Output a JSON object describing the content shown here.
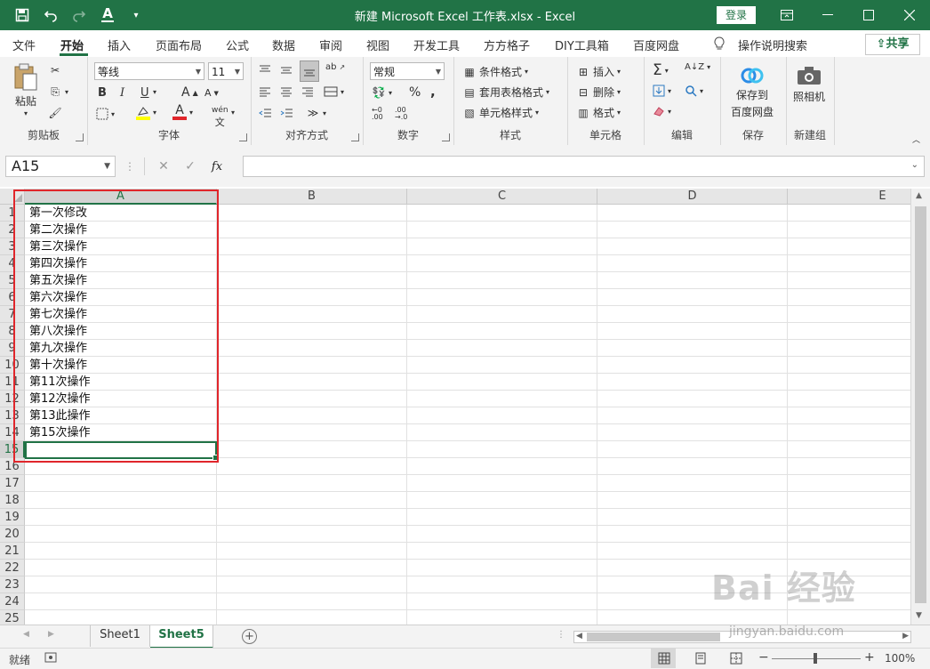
{
  "titlebar": {
    "title": "新建 Microsoft Excel 工作表.xlsx  -  Excel",
    "login": "登录",
    "font_color_letter": "A"
  },
  "ribbon_tabs": [
    "文件",
    "开始",
    "插入",
    "页面布局",
    "公式",
    "数据",
    "审阅",
    "视图",
    "开发工具",
    "方方格子",
    "DIY工具箱",
    "百度网盘"
  ],
  "active_tab": "开始",
  "tell_me": "操作说明搜索",
  "share": "共享",
  "groups": {
    "clipboard": {
      "label": "剪贴板",
      "paste": "粘贴"
    },
    "font": {
      "label": "字体",
      "font_name": "等线",
      "font_size": "11",
      "bold": "B",
      "italic": "I",
      "underline": "U",
      "grow": "A",
      "shrink": "A",
      "wen": "wén"
    },
    "alignment": {
      "label": "对齐方式"
    },
    "number": {
      "label": "数字",
      "format": "常规",
      "percent": "%",
      "comma": ","
    },
    "styles": {
      "label": "样式",
      "conditional": "条件格式",
      "table": "套用表格格式",
      "cell_styles": "单元格样式"
    },
    "cells": {
      "label": "单元格",
      "insert": "插入",
      "delete": "删除",
      "format": "格式"
    },
    "editing": {
      "label": "编辑"
    },
    "save": {
      "label": "保存",
      "button": "保存到\n百度网盘",
      "line1": "保存到",
      "line2": "百度网盘"
    },
    "newgroup": {
      "label": "新建组",
      "camera": "照相机"
    }
  },
  "namebox": "A15",
  "formula": "",
  "fx": "fx",
  "columns": [
    "A",
    "B",
    "C",
    "D",
    "E"
  ],
  "rows": [
    "1",
    "2",
    "3",
    "4",
    "5",
    "6",
    "7",
    "8",
    "9",
    "10",
    "11",
    "12",
    "13",
    "14",
    "15",
    "16",
    "17",
    "18",
    "19",
    "20",
    "21",
    "22",
    "23",
    "24",
    "25"
  ],
  "cells_a": [
    "第一次修改",
    "第二次操作",
    "第三次操作",
    "第四次操作",
    "第五次操作",
    "第六次操作",
    "第七次操作",
    "第八次操作",
    "第九次操作",
    "第十次操作",
    "第11次操作",
    "第12次操作",
    "第13此操作",
    "第15次操作"
  ],
  "sheets": [
    "Sheet1",
    "Sheet5"
  ],
  "active_sheet": "Sheet5",
  "status": {
    "ready": "就绪",
    "zoom": "100%"
  },
  "watermark": {
    "logo": "Bai 经验",
    "url": "jingyan.baidu.com"
  },
  "colors": {
    "accent": "#217346",
    "highlight": "#e0262b"
  }
}
